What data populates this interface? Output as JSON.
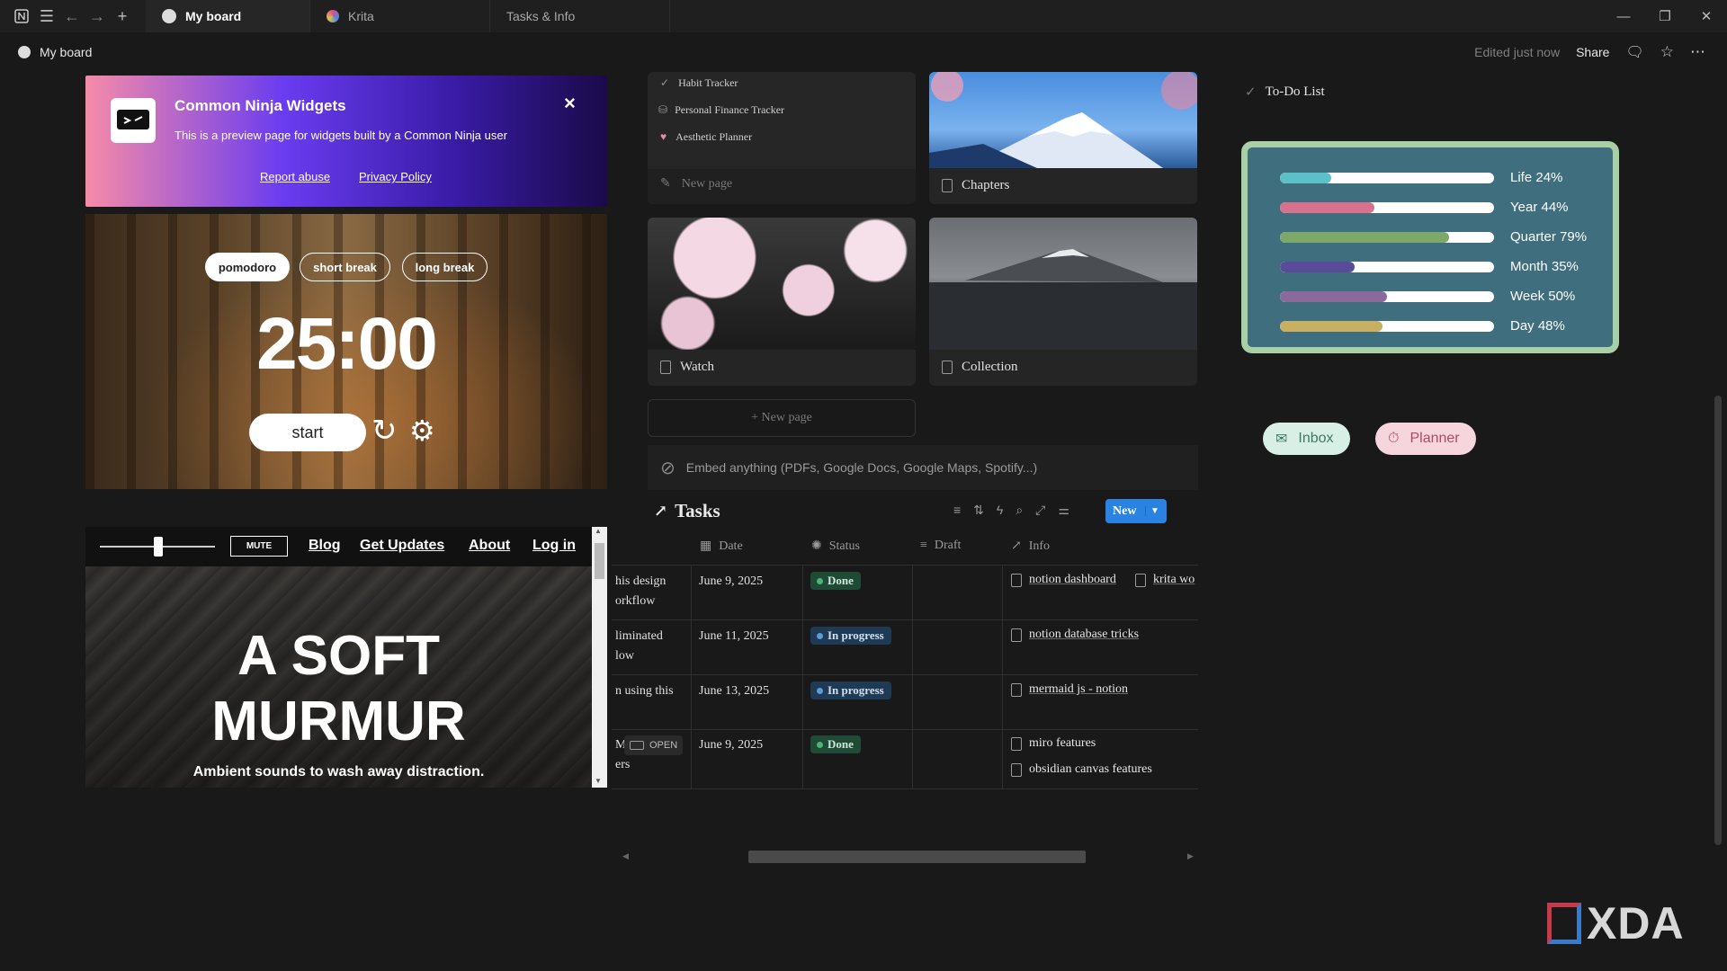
{
  "tabs": [
    {
      "label": "My board",
      "active": true
    },
    {
      "label": "Krita",
      "active": false
    },
    {
      "label": "Tasks & Info",
      "active": false
    }
  ],
  "header": {
    "title": "My board",
    "edited": "Edited just now",
    "share": "Share"
  },
  "ninja": {
    "title": "Common Ninja Widgets",
    "desc": "This is a preview page for widgets built by a Common Ninja user",
    "report": "Report abuse",
    "privacy": "Privacy Policy",
    "close": "×"
  },
  "pomodoro": {
    "modes": [
      "pomodoro",
      "short break",
      "long break"
    ],
    "time": "25:00",
    "start": "start"
  },
  "murmur": {
    "mute": "MUTE",
    "nav": [
      "Blog",
      "Get Updates",
      "About",
      "Log in"
    ],
    "hero_line1": "A SOFT",
    "hero_line2": "MURMUR",
    "tagline": "Ambient sounds to wash away distraction.",
    "volume": 0.5
  },
  "gallery": {
    "list_items": [
      "Habit Tracker",
      "Personal Finance Tracker",
      "Aesthetic Planner"
    ],
    "new_page": "New page",
    "cards": [
      "Chapters",
      "Watch",
      "Collection"
    ],
    "new_page_button": "+ New page",
    "embed": "Embed anything (PDFs, Google Docs, Google Maps, Spotify...)"
  },
  "tasks": {
    "title": "Tasks",
    "new_button": "New",
    "columns": [
      "Date",
      "Status",
      "Draft",
      "Info"
    ],
    "rows": [
      {
        "name1": "his design",
        "name2": "orkflow",
        "date": "June 9, 2025",
        "status": "Done",
        "info": [
          "notion dashboard",
          "krita wo"
        ]
      },
      {
        "name1": "liminated",
        "name2": "low",
        "date": "June 11, 2025",
        "status": "In progress",
        "info": [
          "notion database tricks"
        ]
      },
      {
        "name1": "n using this",
        "name2": "",
        "date": "June 13, 2025",
        "status": "In progress",
        "info": [
          "mermaid js - notion"
        ]
      },
      {
        "name1": "M",
        "name2": "ers",
        "open": "OPEN",
        "date": "June 9, 2025",
        "status": "Done",
        "info": [
          "miro features",
          "obsidian canvas features"
        ]
      }
    ]
  },
  "todo": {
    "label": "To-Do List"
  },
  "progress": [
    {
      "label": "Life 24%",
      "value": 24,
      "color": "#5bc0c8"
    },
    {
      "label": "Year 44%",
      "value": 44,
      "color": "#d8708e"
    },
    {
      "label": "Quarter 79%",
      "value": 79,
      "color": "#7ca86a"
    },
    {
      "label": "Month 35%",
      "value": 35,
      "color": "#5a4a9a"
    },
    {
      "label": "Week 50%",
      "value": 50,
      "color": "#8a6a9a"
    },
    {
      "label": "Day 48%",
      "value": 48,
      "color": "#c8b060"
    }
  ],
  "chips": [
    {
      "label": "Inbox",
      "bg": "#d8efe6",
      "fg": "#3e7a66"
    },
    {
      "label": "Planner",
      "bg": "#f6d6dc",
      "fg": "#b04a64"
    }
  ],
  "watermark": "XDA"
}
